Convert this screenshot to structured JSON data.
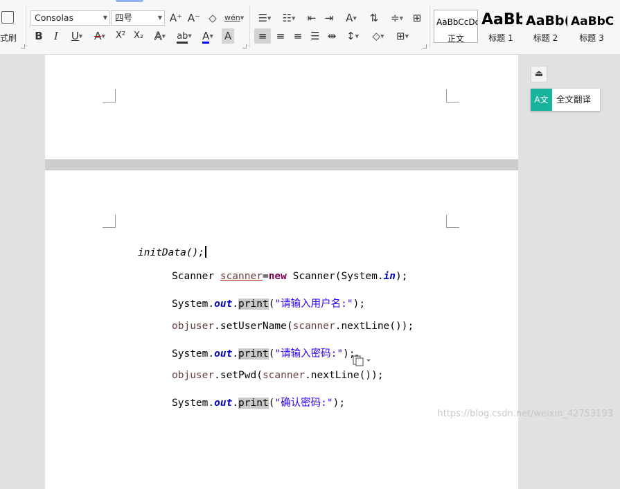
{
  "ribbon": {
    "format_painter_label": "格式刷",
    "font_name": "Consolas",
    "font_size": "四号",
    "increase_font_glyph": "A⁺",
    "decrease_font_glyph": "A⁻",
    "clear_format_glyph": "◇",
    "phonetic_glyph": "wén",
    "bold_glyph": "B",
    "italic_glyph": "I",
    "underline_glyph": "U",
    "strikethrough_glyph": "A",
    "superscript_glyph": "X²",
    "subscript_glyph": "X₂",
    "text_effect_glyph": "A",
    "highlight_glyph": "ab",
    "font_color_glyph": "A",
    "char_shading_glyph": "A",
    "styles": [
      {
        "sample": "AaBbCcDd",
        "caption": "正文"
      },
      {
        "sample": "AaBb",
        "caption": "标题 1"
      },
      {
        "sample": "AaBb(",
        "caption": "标题 2"
      },
      {
        "sample": "AaBbC(",
        "caption": "标题 3"
      }
    ],
    "colors": {
      "font_color_bar": "#0000ff",
      "accent": "#8fb3f0"
    }
  },
  "side": {
    "collapse_icon": "chevron-up-line-icon",
    "translate_icon_text": "A文",
    "translate_label": "全文翻译",
    "translate_color": "#17b39a"
  },
  "document": {
    "code": {
      "l1": "initData();",
      "l2": {
        "a": "Scanner ",
        "b": "scanner",
        "c": "=",
        "d": "new",
        "e": " Scanner(System.",
        "f": "in",
        "g": ");"
      },
      "l3": {
        "a": "System.",
        "b": "out",
        "c": ".",
        "d": "print",
        "e": "(",
        "f": "\"请输入用户名:\"",
        "g": ");"
      },
      "l4": {
        "a": "objuser",
        "b": ".setUserName(",
        "c": "scanner",
        "d": ".nextLine());"
      },
      "l5": {
        "a": "System.",
        "b": "out",
        "c": ".",
        "d": "print",
        "e": "(",
        "f": "\"请输入密码:\"",
        "g": ");"
      },
      "l6": {
        "a": "objuser",
        "b": ".setPwd(",
        "c": "scanner",
        "d": ".nextLine());"
      },
      "l7": {
        "a": "System.",
        "b": "out",
        "c": ".",
        "d": "print",
        "e": "(",
        "f": "\"确认密码:\"",
        "g": ");"
      }
    }
  },
  "watermark": "https://blog.csdn.net/weixin_42753193"
}
